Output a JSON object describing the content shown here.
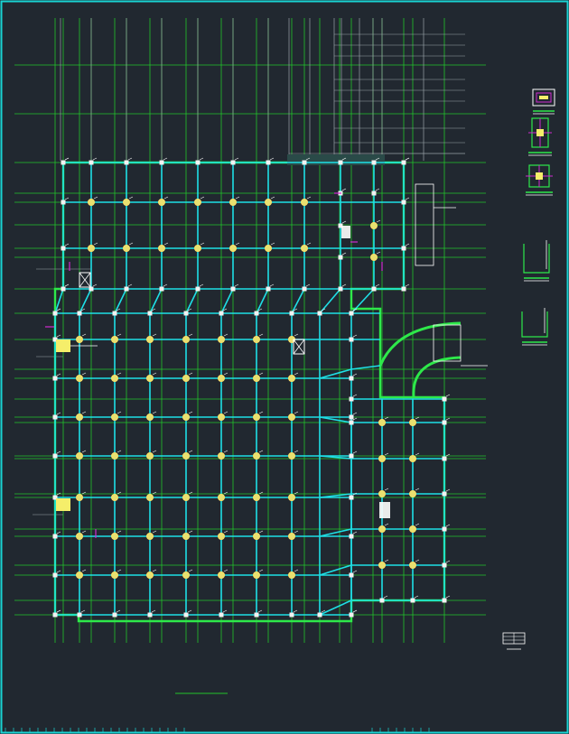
{
  "colors": {
    "background": "#212830",
    "border": "#19d3d3",
    "beam": "#1ee0e6",
    "wall": "#2ee84a",
    "axis": "#22c52a",
    "grey_line": "#9aa3a8",
    "column": "#f2f2f2",
    "pile": "#e8e070",
    "pile_ring": "#ffe066",
    "magenta": "#d02ad0",
    "yellow_block": "#f5ee6a",
    "white": "#ffffff",
    "dark_band": "#2a4a48"
  },
  "icons": [
    "column-icon",
    "pile-icon",
    "elevator-icon",
    "detail-section-icon",
    "legend-table-icon"
  ]
}
